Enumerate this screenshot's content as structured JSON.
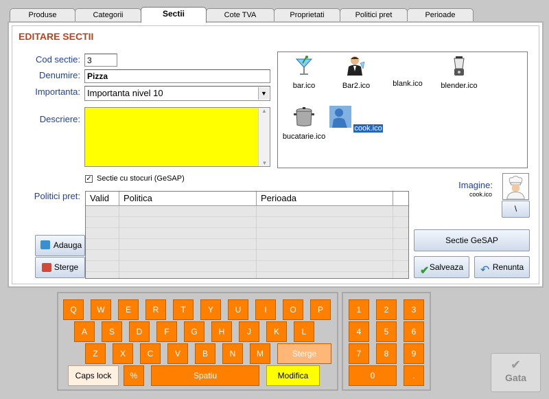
{
  "tabs": [
    "Produse",
    "Categorii",
    "Sectii",
    "Cote TVA",
    "Proprietati",
    "Politici pret",
    "Perioade"
  ],
  "active_tab": "Sectii",
  "form": {
    "title": "EDITARE SECTII",
    "cod_label": "Cod sectie:",
    "cod_value": "3",
    "denumire_label": "Denumire:",
    "denumire_value": "Pizza",
    "importanta_label": "Importanta:",
    "importanta_value": "Importanta nivel 10",
    "descriere_label": "Descriere:",
    "stoc_label": "Sectie cu stocuri (GeSAP)",
    "politici_label": "Politici pret:",
    "imagine_label": "Imagine:",
    "imagine_file": "cook.ico",
    "path_button": "\\"
  },
  "icons": [
    {
      "name": "bar.ico"
    },
    {
      "name": "Bar2.ico"
    },
    {
      "name": "blank.ico"
    },
    {
      "name": "blender.ico"
    },
    {
      "name": "bucatarie.ico"
    },
    {
      "name": "cook.ico"
    }
  ],
  "grid_columns": [
    "Valid",
    "Politica",
    "Perioada"
  ],
  "buttons": {
    "adauga": "Adauga",
    "sterge": "Sterge",
    "gesap": "Sectie GeSAP",
    "salveaza": "Salveaza",
    "renunta": "Renunta",
    "gata": "Gata"
  },
  "keyboard": {
    "row1": [
      "Q",
      "W",
      "E",
      "R",
      "T",
      "Y",
      "U",
      "I",
      "O",
      "P"
    ],
    "row2": [
      "A",
      "S",
      "D",
      "F",
      "G",
      "H",
      "J",
      "K",
      "L"
    ],
    "row3": [
      "Z",
      "X",
      "C",
      "V",
      "B",
      "N",
      "M"
    ],
    "sterge": "Sterge",
    "caps": "Caps lock",
    "percent": "%",
    "space": "Spatiu",
    "modifica": "Modifica",
    "numpad": [
      "1",
      "2",
      "3",
      "4",
      "5",
      "6",
      "7",
      "8",
      "9"
    ],
    "zero": "0",
    "dot": "."
  },
  "colors": {
    "accent_title": "#c0401a",
    "label_blue": "#1f3fa8",
    "key_orange": "#ff7f00",
    "description_bg": "#ffff00"
  }
}
